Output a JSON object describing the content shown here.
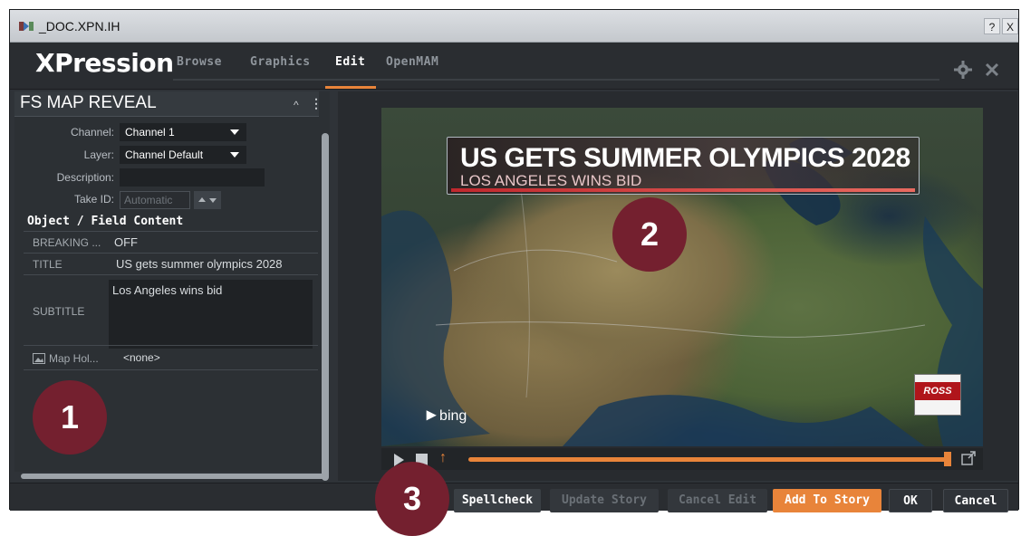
{
  "window": {
    "title": "_DOC.XPN.IH",
    "help_label": "?",
    "close_label": "X"
  },
  "header": {
    "logo": "XPression",
    "tabs": [
      {
        "label": "Browse",
        "active": false
      },
      {
        "label": "Graphics",
        "active": false
      },
      {
        "label": "Edit",
        "active": true
      },
      {
        "label": "OpenMAM",
        "active": false
      }
    ],
    "accent_color": "#e8843a"
  },
  "panel": {
    "title": "FS MAP REVEAL",
    "collapse_icon": "chevron-up",
    "menu_icon": "kebab",
    "channel_label": "Channel:",
    "channel_value": "Channel 1",
    "layer_label": "Layer:",
    "layer_value": "Channel Default",
    "description_label": "Description:",
    "description_value": "",
    "take_id_label": "Take ID:",
    "take_id_placeholder": "Automatic",
    "section_heading": "Object / Field Content",
    "fields": [
      {
        "key": "BREAKING ...",
        "value": "OFF"
      },
      {
        "key": "TITLE",
        "value": "US gets summer olympics 2028"
      },
      {
        "key": "SUBTITLE",
        "value": "Los Angeles wins bid"
      },
      {
        "key": "Map Hol...",
        "value": "<none>",
        "icon": "image"
      }
    ]
  },
  "preview": {
    "headline": "US GETS SUMMER OLYMPICS 2028",
    "subline": "LOS ANGELES WINS BID",
    "bing_label": "bing",
    "ross_label": "ROSS",
    "progress": 1.0
  },
  "footer": {
    "spellcheck": "Spellcheck",
    "update_story": "Update Story",
    "cancel_edit": "Cancel Edit",
    "add_to_story": "Add To Story",
    "ok": "OK",
    "cancel": "Cancel"
  },
  "callouts": {
    "one": "1",
    "two": "2",
    "three": "3"
  }
}
